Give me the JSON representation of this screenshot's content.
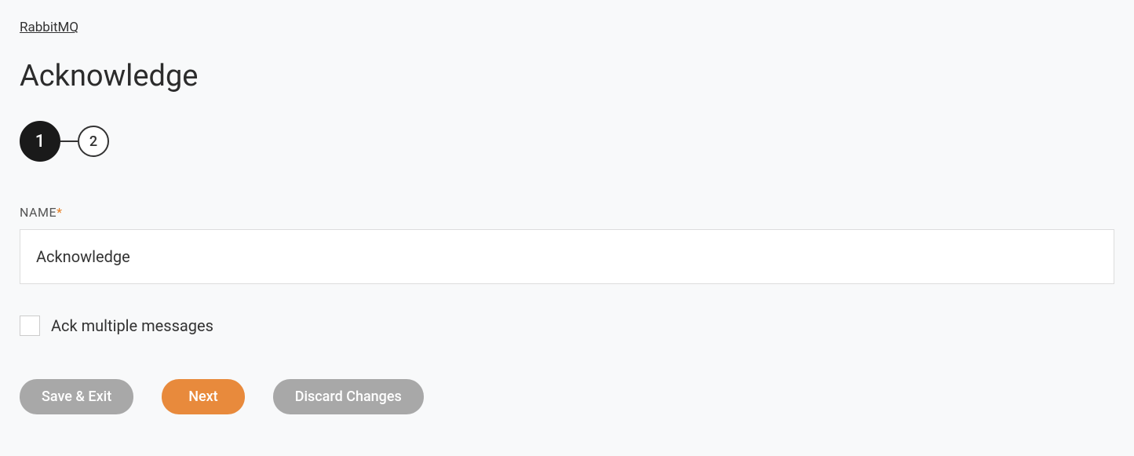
{
  "breadcrumb": {
    "label": "RabbitMQ"
  },
  "page": {
    "title": "Acknowledge"
  },
  "stepper": {
    "steps": [
      "1",
      "2"
    ],
    "active": 0
  },
  "form": {
    "name": {
      "label": "NAME",
      "required_mark": "*",
      "value": "Acknowledge"
    },
    "ack_multiple": {
      "label": "Ack multiple messages",
      "checked": false
    }
  },
  "buttons": {
    "save_exit": "Save & Exit",
    "next": "Next",
    "discard": "Discard Changes"
  }
}
